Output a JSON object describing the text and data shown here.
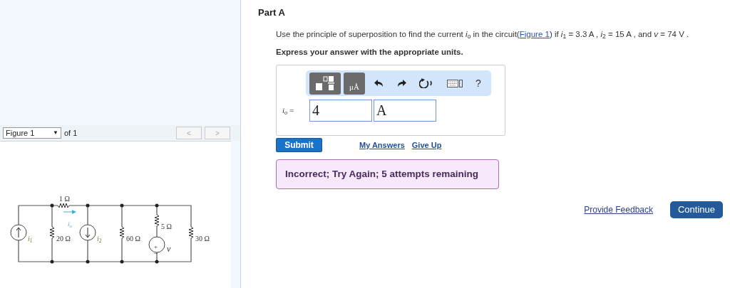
{
  "figure_nav": {
    "select": "Figure 1",
    "caret": "▼",
    "of": "of 1",
    "prev": "<",
    "next": ">"
  },
  "circuit": {
    "r1": "1 Ω",
    "io": "*i*$_{o}$",
    "i1": "*i*$_{1}$",
    "r20": "20 Ω",
    "i2": "*i*$_{2}$",
    "r60": "60 Ω",
    "r5": "5 Ω",
    "plus": "+",
    "minus": "−",
    "v": "*v*",
    "r30": "30 Ω"
  },
  "part": {
    "title": "Part A",
    "prompt_before": "Use the principle of superposition to find the current *i*$_{o}$ in the circuit(",
    "prompt_link": "Figure 1",
    "prompt_after": ") if *i*$_{1}$ = 3.3 A , *i*$_{2}$ = 15 A , and *v* = 74 V .",
    "instruction": "Express your answer with the appropriate units."
  },
  "toolbar": {
    "units": "μÅ",
    "help": "?"
  },
  "answer": {
    "label": "*i*$_{o}$ =",
    "value": "4",
    "unit": "A"
  },
  "actions": {
    "submit": "Submit",
    "my_answers": "My Answers",
    "give_up": "Give Up"
  },
  "feedback": {
    "kind": "incorrect",
    "text": "Incorrect; Try Again; 5 attempts remaining"
  },
  "footer": {
    "provide_feedback": "Provide Feedback",
    "continue": "Continue"
  }
}
